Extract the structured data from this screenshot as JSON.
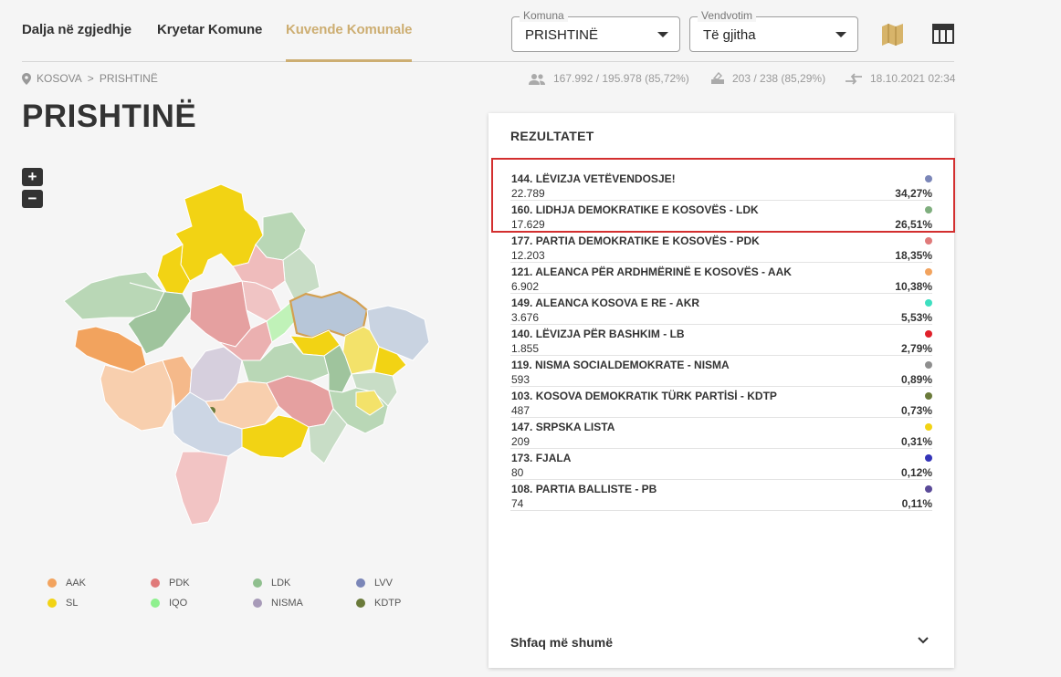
{
  "nav": {
    "tabs": [
      {
        "label": "Dalja në zgjedhje"
      },
      {
        "label": "Kryetar Komune"
      },
      {
        "label": "Kuvende Komunale"
      }
    ]
  },
  "filters": {
    "komuna": {
      "label": "Komuna",
      "value": "PRISHTINË"
    },
    "vendvotim": {
      "label": "Vendvotim",
      "value": "Të gjitha"
    }
  },
  "breadcrumb": {
    "country": "KOSOVA",
    "separator": ">",
    "city": "PRISHTINË"
  },
  "stats": {
    "voters": "167.992 / 195.978 (85,72%)",
    "stations": "203 / 238 (85,29%)",
    "updated": "18.10.2021 02:34"
  },
  "page": {
    "title": "PRISHTINË"
  },
  "zoom": {
    "in": "+",
    "out": "−"
  },
  "results": {
    "title": "REZULTATET",
    "rows": [
      {
        "name": "144. LËVIZJA VETËVENDOSJE!",
        "votes": "22.789",
        "pct": "34,27%",
        "color": "#7b86b8"
      },
      {
        "name": "160. LIDHJA DEMOKRATIKE E KOSOVËS - LDK",
        "votes": "17.629",
        "pct": "26,51%",
        "color": "#7fae7e"
      },
      {
        "name": "177. PARTIA DEMOKRATIKE E KOSOVËS - PDK",
        "votes": "12.203",
        "pct": "18,35%",
        "color": "#e07a7a"
      },
      {
        "name": "121. ALEANCA PËR ARDHMËRINË E KOSOVËS - AAK",
        "votes": "6.902",
        "pct": "10,38%",
        "color": "#f2a35e"
      },
      {
        "name": "149. ALEANCA KOSOVA E RE - AKR",
        "votes": "3.676",
        "pct": "5,53%",
        "color": "#3ddfc0"
      },
      {
        "name": "140. LËVIZJA PËR BASHKIM - LB",
        "votes": "1.855",
        "pct": "2,79%",
        "color": "#e0202a"
      },
      {
        "name": "119. NISMA SOCIALDEMOKRATE - NISMA",
        "votes": "593",
        "pct": "0,89%",
        "color": "#8e8e8e"
      },
      {
        "name": "103. KOSOVA DEMOKRATIK TÜRK PARTİSİ - KDTP",
        "votes": "487",
        "pct": "0,73%",
        "color": "#6a7a3a"
      },
      {
        "name": "147. SRPSKA LISTA",
        "votes": "209",
        "pct": "0,31%",
        "color": "#f2d314"
      },
      {
        "name": "173. FJALA",
        "votes": "80",
        "pct": "0,12%",
        "color": "#3434b8"
      },
      {
        "name": "108. PARTIA BALLISTE - PB",
        "votes": "74",
        "pct": "0,11%",
        "color": "#5a4a98"
      }
    ],
    "more": "Shfaq më shumë"
  },
  "legend": [
    {
      "label": "AAK",
      "color": "#f2a35e"
    },
    {
      "label": "PDK",
      "color": "#e07a7a"
    },
    {
      "label": "LDK",
      "color": "#8fbf8e"
    },
    {
      "label": "LVV",
      "color": "#7b86b8"
    },
    {
      "label": "SL",
      "color": "#f2d314"
    },
    {
      "label": "IQO",
      "color": "#8ef08e"
    },
    {
      "label": "NISMA",
      "color": "#a79ab8"
    },
    {
      "label": "KDTP",
      "color": "#6a7a3a"
    }
  ]
}
